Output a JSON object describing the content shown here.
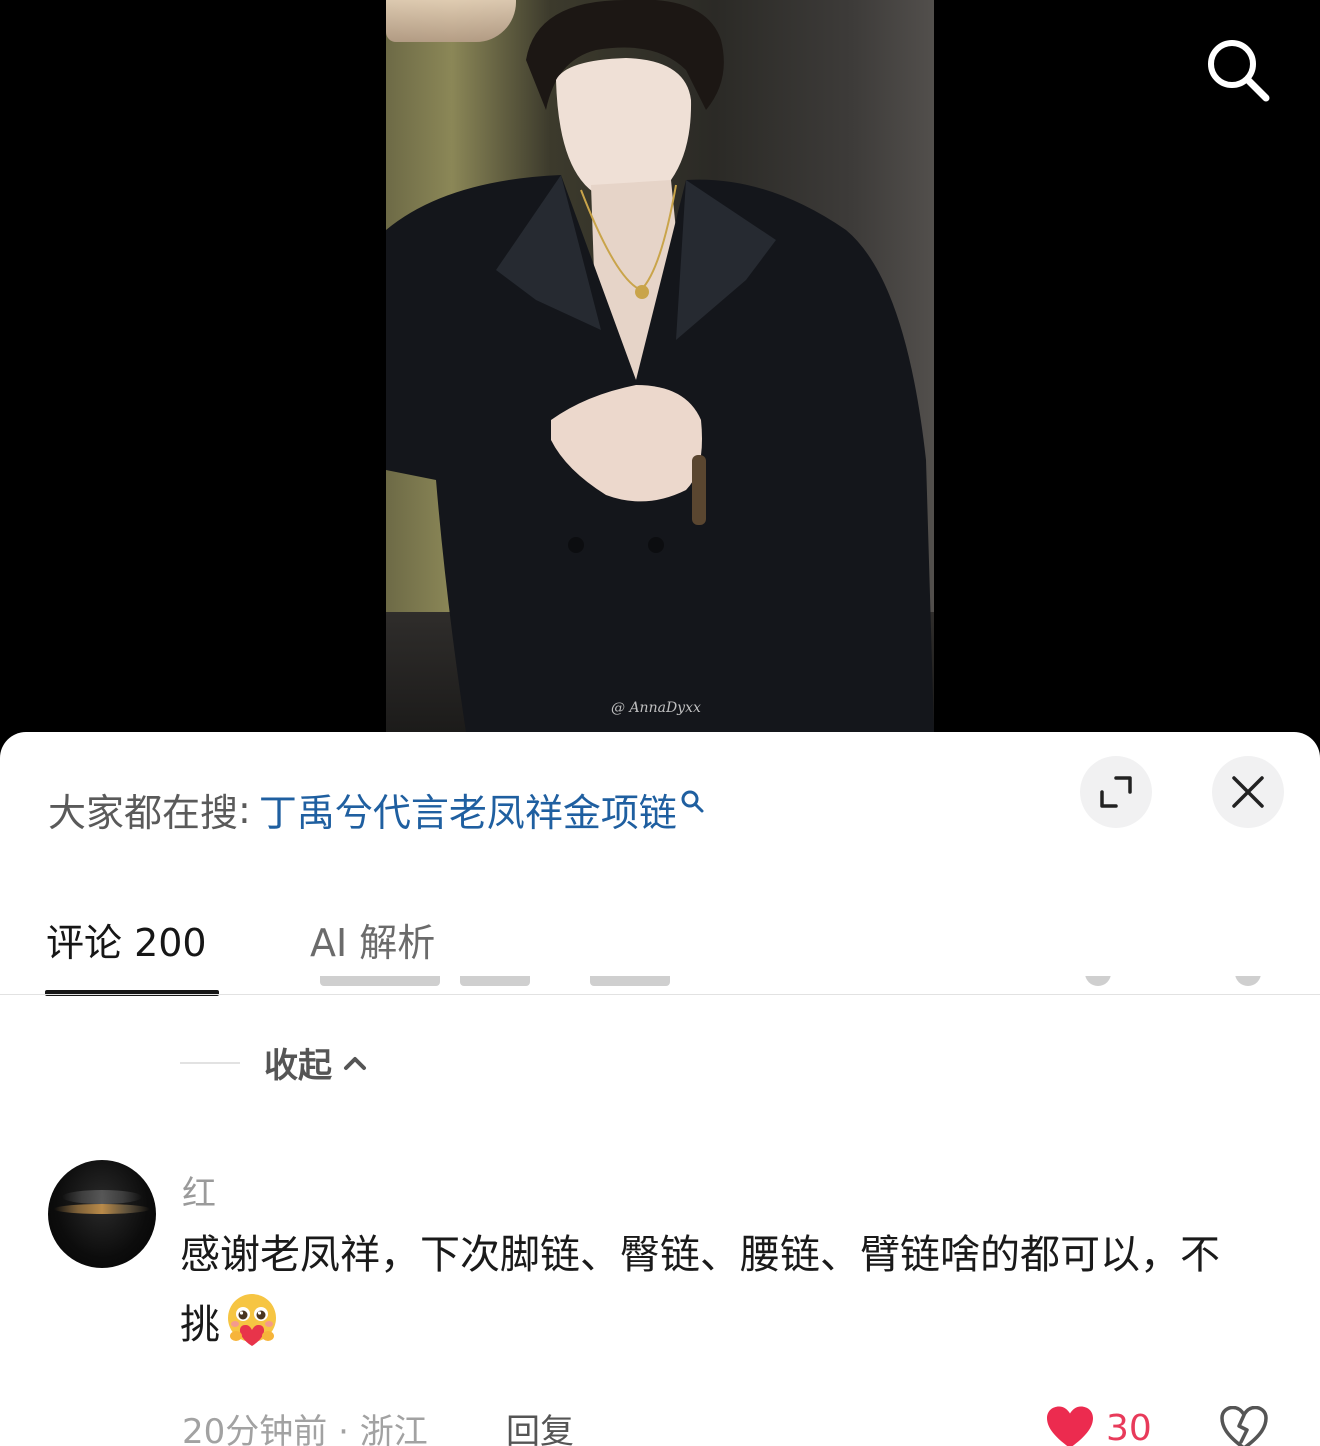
{
  "video": {
    "watermark": "@ AnnaDyxx"
  },
  "icons": {
    "top_search": "search-icon",
    "expand": "expand-icon",
    "close": "close-icon",
    "collapse_chevron": "chevron-up-icon",
    "like": "heart-icon",
    "dislike": "broken-heart-icon"
  },
  "trending": {
    "label": "大家都在搜",
    "colon": ":",
    "term": "丁禹兮代言老凤祥金项链"
  },
  "tabs": [
    {
      "label": "评论 200",
      "active": true
    },
    {
      "label": "AI 解析",
      "active": false
    }
  ],
  "collapse": {
    "label": "收起"
  },
  "comment": {
    "username": "红",
    "text": "感谢老凤祥，下次脚链、臀链、腰链、臂链啥的都可以，不挑",
    "emoji": "face-holding-back-tears-with-heart",
    "time": "20分钟前",
    "separator": " · ",
    "location": "浙江",
    "reply_label": "回复",
    "like_count": "30",
    "liked": true
  },
  "colors": {
    "accent_link": "#1f5fa0",
    "like_red": "#e83a5a",
    "sheet_bg": "#ffffff",
    "video_bg": "#000000"
  }
}
